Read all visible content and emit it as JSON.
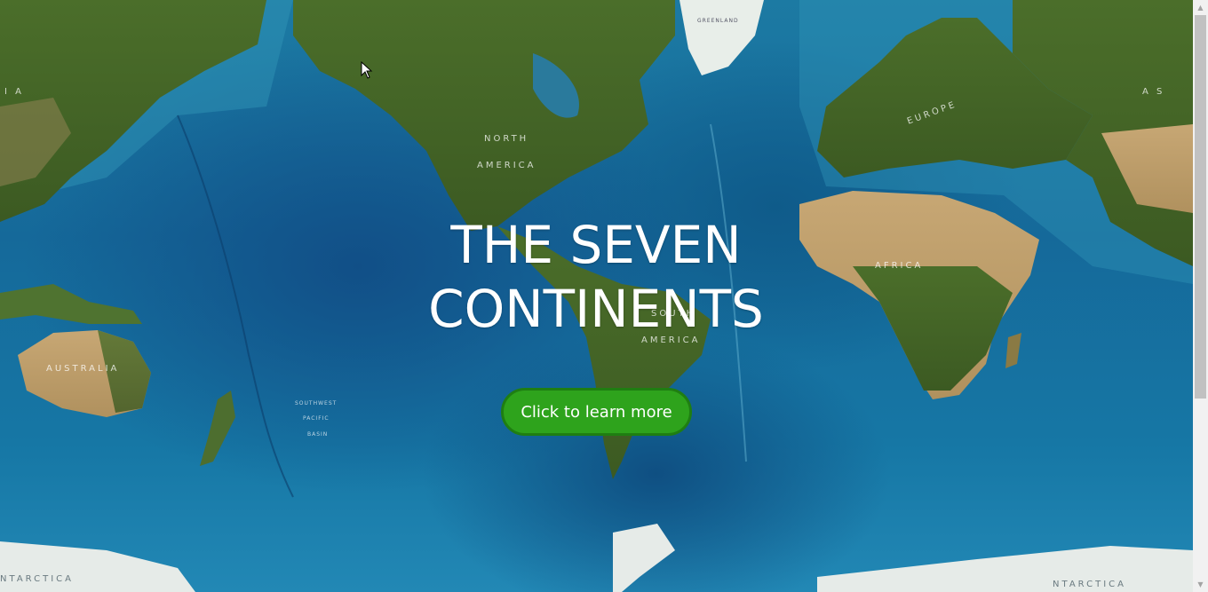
{
  "hero": {
    "title_line1": "THE SEVEN",
    "title_line2": "CONTINENTS",
    "cta_label": "Click to learn more"
  },
  "map_labels": {
    "north_america_1": "NORTH",
    "north_america_2": "AMERICA",
    "south_america_1": "SOUTH",
    "south_america_2": "AMERICA",
    "europe": "EUROPE",
    "africa": "AFRICA",
    "australia": "AUSTRALIA",
    "asia_left": "I A",
    "asia_right": "A S",
    "antarctica_left": "NTARCTICA",
    "antarctica_right": "NTARCTICA",
    "greenland": "GREENLAND",
    "sw_pacific_1": "SOUTHWEST",
    "sw_pacific_2": "PACIFIC",
    "sw_pacific_3": "BASIN"
  },
  "colors": {
    "button_bg": "#2ea31c",
    "button_border": "#1f7e12",
    "title_text": "#ffffff"
  },
  "icons": {
    "scroll_up": "triangle-up",
    "scroll_down": "triangle-down",
    "pointer": "arrow-cursor"
  }
}
